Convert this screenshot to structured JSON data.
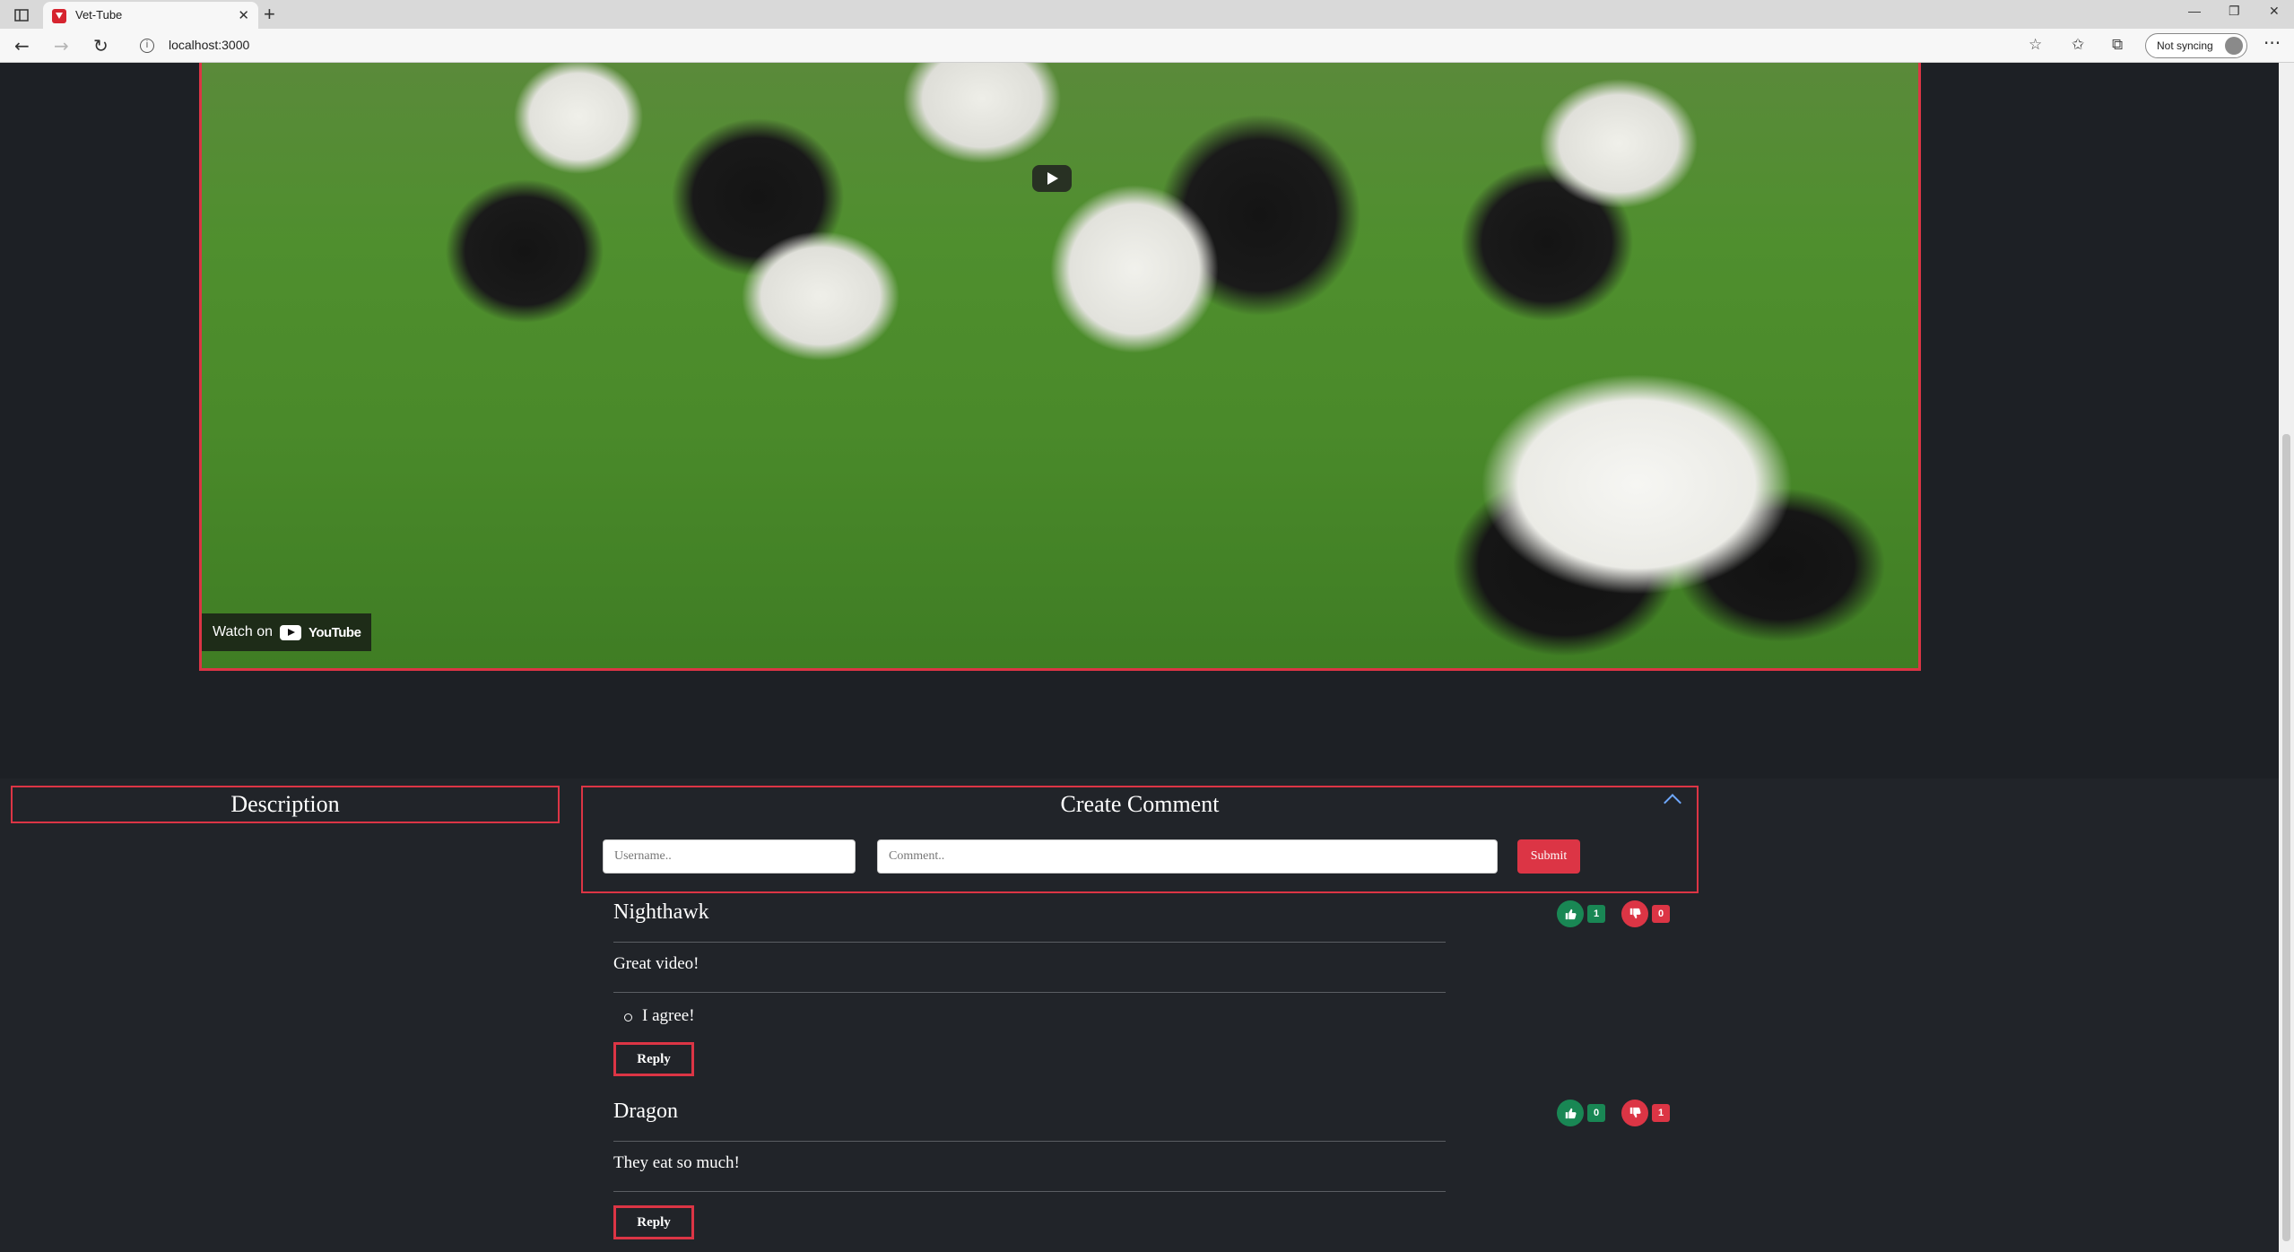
{
  "browser": {
    "tab_title": "Vet-Tube",
    "tab_close": "✕",
    "new_tab": "+",
    "url": "localhost:3000",
    "sync_label": "Not syncing",
    "more": "···",
    "window_minimize": "—",
    "window_restore": "❐",
    "window_close": "✕"
  },
  "video": {
    "watch_on": "Watch on",
    "youtube": "YouTube"
  },
  "description": {
    "title": "Description"
  },
  "create_comment": {
    "title": "Create Comment",
    "username_placeholder": "Username..",
    "comment_placeholder": "Comment..",
    "submit_label": "Submit"
  },
  "comments": [
    {
      "author": "Nighthawk",
      "text": "Great video!",
      "replies": [
        "I agree!"
      ],
      "likes": "1",
      "dislikes": "0",
      "reply_label": "Reply"
    },
    {
      "author": "Dragon",
      "text": "They eat so much!",
      "replies": [],
      "likes": "0",
      "dislikes": "1",
      "reply_label": "Reply"
    }
  ],
  "colors": {
    "accent": "#dc3545",
    "like": "#198754",
    "background": "#212429"
  }
}
